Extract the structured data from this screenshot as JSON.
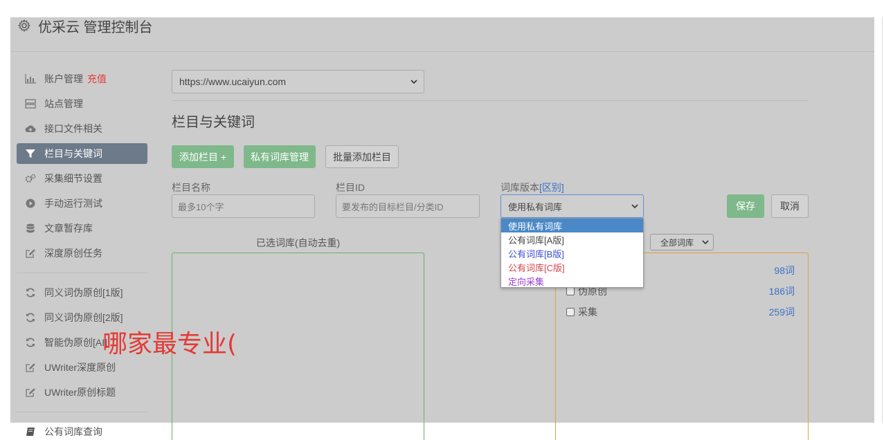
{
  "header": {
    "title": "优采云 管理控制台",
    "icon": "gear-icon"
  },
  "sidebar": {
    "items": [
      {
        "label": "账户管理",
        "extra": "充值",
        "icon": "bar-chart-icon"
      },
      {
        "label": "站点管理",
        "icon": "server-icon"
      },
      {
        "label": "接口文件相关",
        "icon": "cloud-upload-icon"
      },
      {
        "label": "栏目与关键词",
        "icon": "filter-icon",
        "active": true
      },
      {
        "label": "采集细节设置",
        "icon": "cogs-icon"
      },
      {
        "label": "手动运行测试",
        "icon": "play-circle-icon"
      },
      {
        "label": "文章暂存库",
        "icon": "database-icon"
      },
      {
        "label": "深度原创任务",
        "icon": "edit-icon"
      },
      {
        "label": "同义词伪原创[1版]",
        "icon": "refresh-icon"
      },
      {
        "label": "同义词伪原创[2版]",
        "icon": "refresh-icon"
      },
      {
        "label": "智能伪原创[AI]",
        "icon": "refresh-icon"
      },
      {
        "label": "UWriter深度原创",
        "icon": "edit-icon"
      },
      {
        "label": "UWriter原创标题",
        "icon": "edit-icon"
      },
      {
        "label": "公有词库查询",
        "icon": "book-icon"
      }
    ]
  },
  "main": {
    "site_select": "https://www.ucaiyun.com",
    "section_title": "栏目与关键词",
    "buttons": {
      "add_column": "添加栏目 +",
      "private_lib": "私有词库管理",
      "batch_add": "批量添加栏目",
      "save": "保存",
      "cancel": "取消"
    },
    "form": {
      "name_label": "栏目名称",
      "name_placeholder": "最多10个字",
      "id_label": "栏目ID",
      "id_placeholder": "要发布的目标栏目/分类ID",
      "version_label": "词库版本",
      "version_label_accent": "[区别]",
      "version_value": "使用私有词库",
      "version_options": [
        {
          "label": "使用私有词库",
          "color": "#ffffff",
          "selected": true
        },
        {
          "label": "公有词库[A版]",
          "color": "#444444"
        },
        {
          "label": "公有词库[B版]",
          "color": "#3b4fd0"
        },
        {
          "label": "公有词库[C版]",
          "color": "#d0464f"
        },
        {
          "label": "定向采集",
          "color": "#9b3fd0"
        }
      ]
    },
    "selected_panel_title": "已选词库(自动去重)",
    "filter_select": "全部词库",
    "libraries": [
      {
        "label": "",
        "count": "98词"
      },
      {
        "label": "伪原创",
        "count": "186词"
      },
      {
        "label": "采集",
        "count": "259词"
      }
    ],
    "overlay_text": "哪家最专业("
  }
}
